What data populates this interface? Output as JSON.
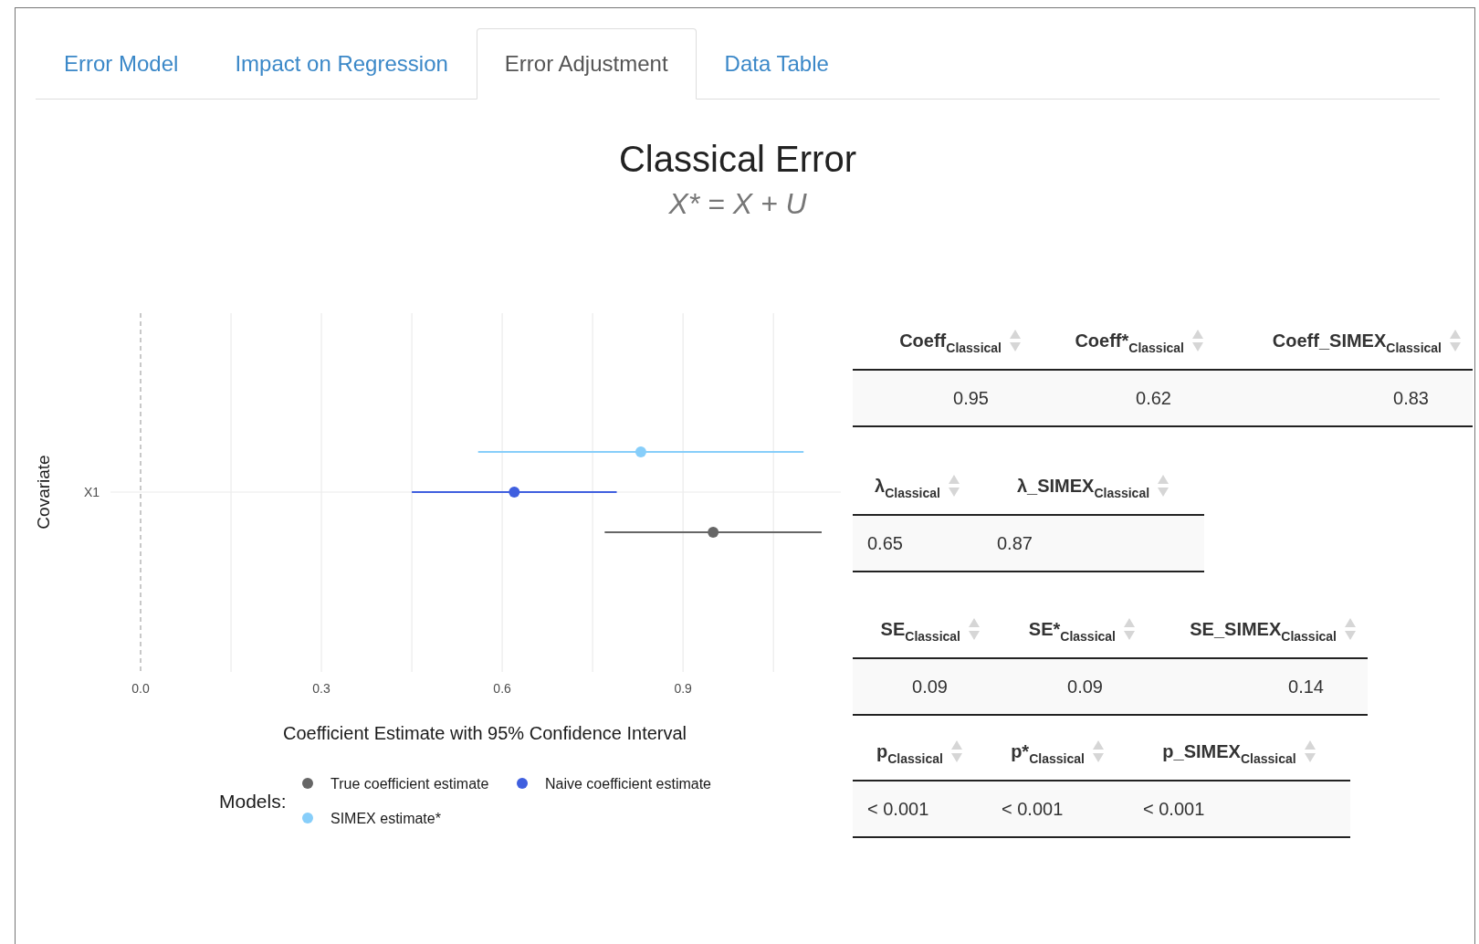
{
  "tabs": [
    {
      "label": "Error Model",
      "selected": false
    },
    {
      "label": "Impact on Regression",
      "selected": false
    },
    {
      "label": "Error Adjustment",
      "selected": true
    },
    {
      "label": "Data Table",
      "selected": false
    }
  ],
  "title": "Classical Error",
  "formula": "X* = X + U",
  "chart": {
    "chart_data": {
      "type": "scatter",
      "orientation": "horizontal",
      "xlabel": "Coefficient Estimate with 95% Confidence Interval",
      "ylabel": "Covariate",
      "categories": [
        "X1"
      ],
      "grid": true,
      "legend": true,
      "ref_lines": [
        {
          "axis": "x",
          "value": 0
        }
      ],
      "xlim": [
        -0.05,
        1.18
      ],
      "xticks": [
        {
          "value": 0,
          "label": "0.0"
        },
        {
          "value": 0.3,
          "label": "0.3"
        },
        {
          "value": 0.6,
          "label": "0.6"
        },
        {
          "value": 0.9,
          "label": "0.9"
        }
      ],
      "series": [
        {
          "name": "True coefficient estimate",
          "color": "#666666",
          "values": [
            0.95
          ],
          "errors": [
            0.18
          ]
        },
        {
          "name": "Naive coefficient estimate",
          "color": "#3f5fdf",
          "values": [
            0.62
          ],
          "errors": [
            0.17
          ]
        },
        {
          "name": "SIMEX estimate*",
          "color": "#87cefa",
          "values": [
            0.83
          ],
          "errors": [
            0.27
          ]
        }
      ]
    },
    "legend_title": "Models:"
  },
  "tables": [
    {
      "columns": [
        "Coeff$_{Classical}$",
        "Coeff*$_{Classical}$",
        "Coeff_SIMEX$_{Classical}$"
      ],
      "rows": [
        [
          "0.95",
          "0.62",
          "0.83"
        ]
      ]
    },
    {
      "columns": [
        "λ$_{Classical}$",
        "λ_SIMEX$_{Classical}$"
      ],
      "rows": [
        [
          "0.65",
          "0.87"
        ]
      ]
    },
    {
      "columns": [
        "SE$_{Classical}$",
        "SE*$_{Classical}$",
        "SE_SIMEX$_{Classical}$"
      ],
      "rows": [
        [
          "0.09",
          "0.09",
          "0.14"
        ]
      ]
    },
    {
      "columns": [
        "p$_{Classical}$",
        "p*$_{Classical}$",
        "p_SIMEX$_{Classical}$"
      ],
      "rows": [
        [
          "< 0.001",
          "< 0.001",
          "< 0.001"
        ]
      ]
    }
  ]
}
